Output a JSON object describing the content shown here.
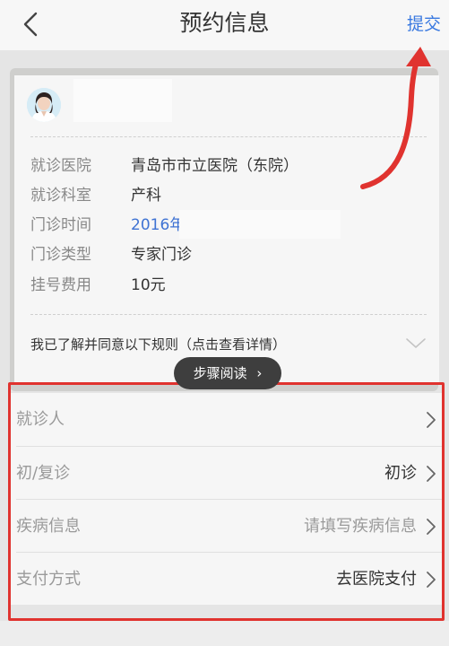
{
  "navbar": {
    "title": "预约信息",
    "submit_label": "提交"
  },
  "doctor": {
    "hospital_label": "就诊医院",
    "hospital_value": "青岛市市立医院（东院）",
    "department_label": "就诊科室",
    "department_value": "产科",
    "time_label": "门诊时间",
    "time_value": "2016年",
    "type_label": "门诊类型",
    "type_value": "专家门诊",
    "fee_label": "挂号费用",
    "fee_value": "10元"
  },
  "rules": {
    "text": "我已了解并同意以下规则（点击查看详情）"
  },
  "step_pill": {
    "label": "步骤阅读"
  },
  "list": {
    "patient_label": "就诊人",
    "visit_label": "初/复诊",
    "visit_value": "初诊",
    "disease_label": "疾病信息",
    "disease_placeholder": "请填写疾病信息",
    "payment_label": "支付方式",
    "payment_value": "去医院支付"
  },
  "colors": {
    "accent": "#3878e0",
    "annotation_red": "#e0332f"
  }
}
